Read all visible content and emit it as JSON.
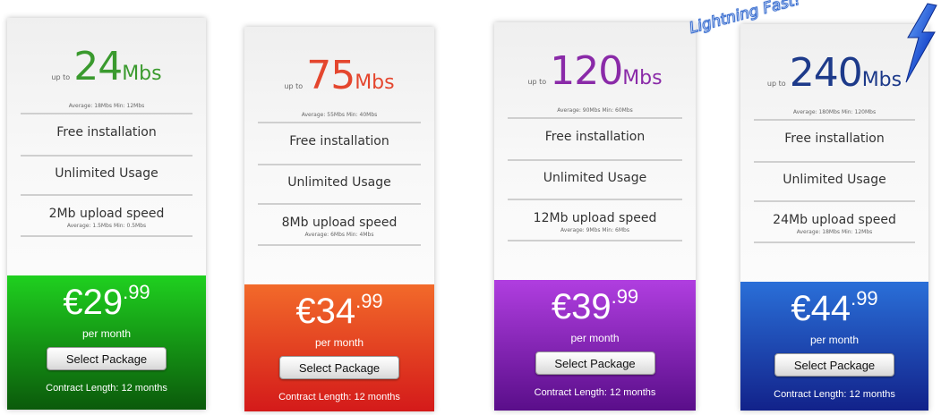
{
  "packages": [
    {
      "speed_prefix": "up to",
      "speed_value": "24",
      "speed_unit": "Mbs",
      "speed_color": "#3a9a2e",
      "speed_avg": "Average: 18Mbs  Min: 12Mbs",
      "features": [
        "Free installation",
        "Unlimited Usage",
        "2Mb upload speed"
      ],
      "upload_avg": "Average: 1.5Mbs  Min: 0.5Mbs",
      "price_currency": "€",
      "price_main": "29",
      "price_cents": ".99",
      "price_period": "per month",
      "select_label": "Select Package",
      "contract": "Contract Length: 12 months",
      "panel_color_top": "#1fd01f",
      "panel_color_bottom": "#0b5a0b"
    },
    {
      "speed_prefix": "up to",
      "speed_value": "75",
      "speed_unit": "Mbs",
      "speed_color": "#e4462e",
      "speed_avg": "Average: 55Mbs  Min: 40Mbs",
      "features": [
        "Free installation",
        "Unlimited Usage",
        "8Mb upload speed"
      ],
      "upload_avg": "Average: 6Mbs  Min: 4Mbs",
      "price_currency": "€",
      "price_main": "34",
      "price_cents": ".99",
      "price_period": "per month",
      "select_label": "Select Package",
      "contract": "Contract Length: 12 months",
      "panel_color_top": "#f26a2a",
      "panel_color_bottom": "#d41a1a"
    },
    {
      "speed_prefix": "up to",
      "speed_value": "120",
      "speed_unit": "Mbs",
      "speed_color": "#8a2aa8",
      "speed_avg": "Average: 90Mbs  Min: 60Mbs",
      "features": [
        "Free installation",
        "Unlimited Usage",
        "12Mb upload speed"
      ],
      "upload_avg": "Average: 9Mbs  Min: 6Mbs",
      "price_currency": "€",
      "price_main": "39",
      "price_cents": ".99",
      "price_period": "per month",
      "select_label": "Select Package",
      "contract": "Contract Length: 12 months",
      "panel_color_top": "#b03ee0",
      "panel_color_bottom": "#5a0e8a"
    },
    {
      "speed_prefix": "up to",
      "speed_value": "240",
      "speed_unit": "Mbs",
      "speed_color": "#1d3a8a",
      "speed_avg": "Average: 180Mbs  Min: 120Mbs",
      "features": [
        "Free installation",
        "Unlimited Usage",
        "24Mb upload speed"
      ],
      "upload_avg": "Average: 18Mbs  Min: 12Mbs",
      "price_currency": "€",
      "price_main": "44",
      "price_cents": ".99",
      "price_period": "per month",
      "select_label": "Select Package",
      "contract": "Contract Length: 12 months",
      "panel_color_top": "#2a6fd8",
      "panel_color_bottom": "#12228a",
      "badge_text": "Lightning Fast!",
      "badge_icon": "lightning-bolt-icon"
    }
  ]
}
